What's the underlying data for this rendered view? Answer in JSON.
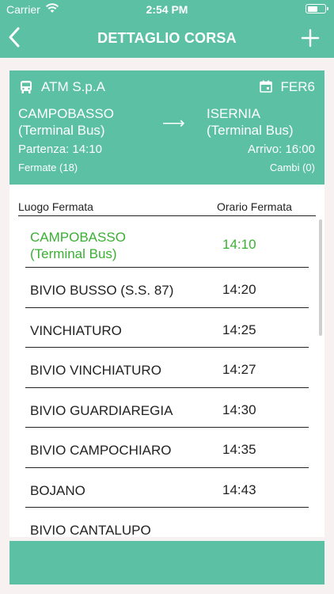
{
  "status_bar": {
    "carrier": "Carrier",
    "time": "2:54 PM",
    "battery_level": 0.6
  },
  "nav": {
    "title": "DETTAGLIO CORSA",
    "back_icon": "chevron-left-icon",
    "add_icon": "plus-icon"
  },
  "summary": {
    "operator": "ATM S.p.A",
    "route_code": "FER6",
    "origin_line1": "CAMPOBASSO",
    "origin_line2": "(Terminal Bus)",
    "arrow": "⟶",
    "destination_line1": "ISERNIA",
    "destination_line2": "(Terminal Bus)",
    "departure": "Partenza: 14:10",
    "arrival": "Arrivo: 16:00",
    "stops": "Fermate (18)",
    "changes": "Cambi (0)"
  },
  "table": {
    "header_place": "Luogo Fermata",
    "header_time": "Orario Fermata",
    "rows": [
      {
        "place_line1": "CAMPOBASSO",
        "place_line2": "(Terminal Bus)",
        "time": "14:10"
      },
      {
        "place_line1": "BIVIO BUSSO (S.S. 87)",
        "time": "14:20"
      },
      {
        "place_line1": "VINCHIATURO",
        "time": "14:25"
      },
      {
        "place_line1": "BIVIO VINCHIATURO",
        "time": "14:27"
      },
      {
        "place_line1": "BIVIO GUARDIAREGIA",
        "time": "14:30"
      },
      {
        "place_line1": "BIVIO CAMPOCHIARO",
        "time": "14:35"
      },
      {
        "place_line1": "BOJANO",
        "time": "14:43"
      },
      {
        "place_line1": "BIVIO CANTALUPO",
        "time": ""
      }
    ]
  },
  "colors": {
    "accent": "#5bc0a4",
    "current_stop": "#3ab033",
    "background": "#f7f1f1"
  }
}
